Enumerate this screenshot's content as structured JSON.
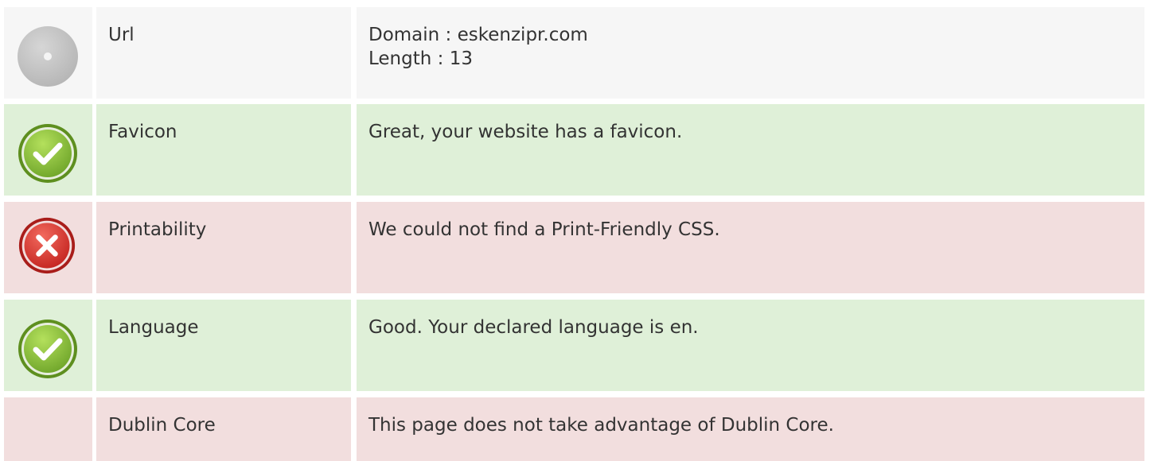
{
  "colors": {
    "neutral_bg": "#f6f6f6",
    "good_bg": "#dff0d8",
    "bad_bg": "#f2dede",
    "good_icon": "#8cc63f",
    "bad_icon": "#e0322e",
    "neutral_icon": "#c4c4c4"
  },
  "rows": [
    {
      "status": "neutral",
      "icon": "neutral-dot-icon",
      "label": "Url",
      "lines": [
        "Domain : eskenzipr.com",
        "Length : 13"
      ]
    },
    {
      "status": "good",
      "icon": "check-icon",
      "label": "Favicon",
      "lines": [
        "Great, your website has a favicon."
      ]
    },
    {
      "status": "bad",
      "icon": "cross-icon",
      "label": "Printability",
      "lines": [
        "We could not find a Print-Friendly CSS."
      ]
    },
    {
      "status": "good",
      "icon": "check-icon",
      "label": "Language",
      "lines": [
        "Good. Your declared language is en."
      ]
    },
    {
      "status": "bad",
      "icon": "",
      "label": "Dublin Core",
      "lines": [
        "This page does not take advantage of Dublin Core."
      ]
    }
  ]
}
